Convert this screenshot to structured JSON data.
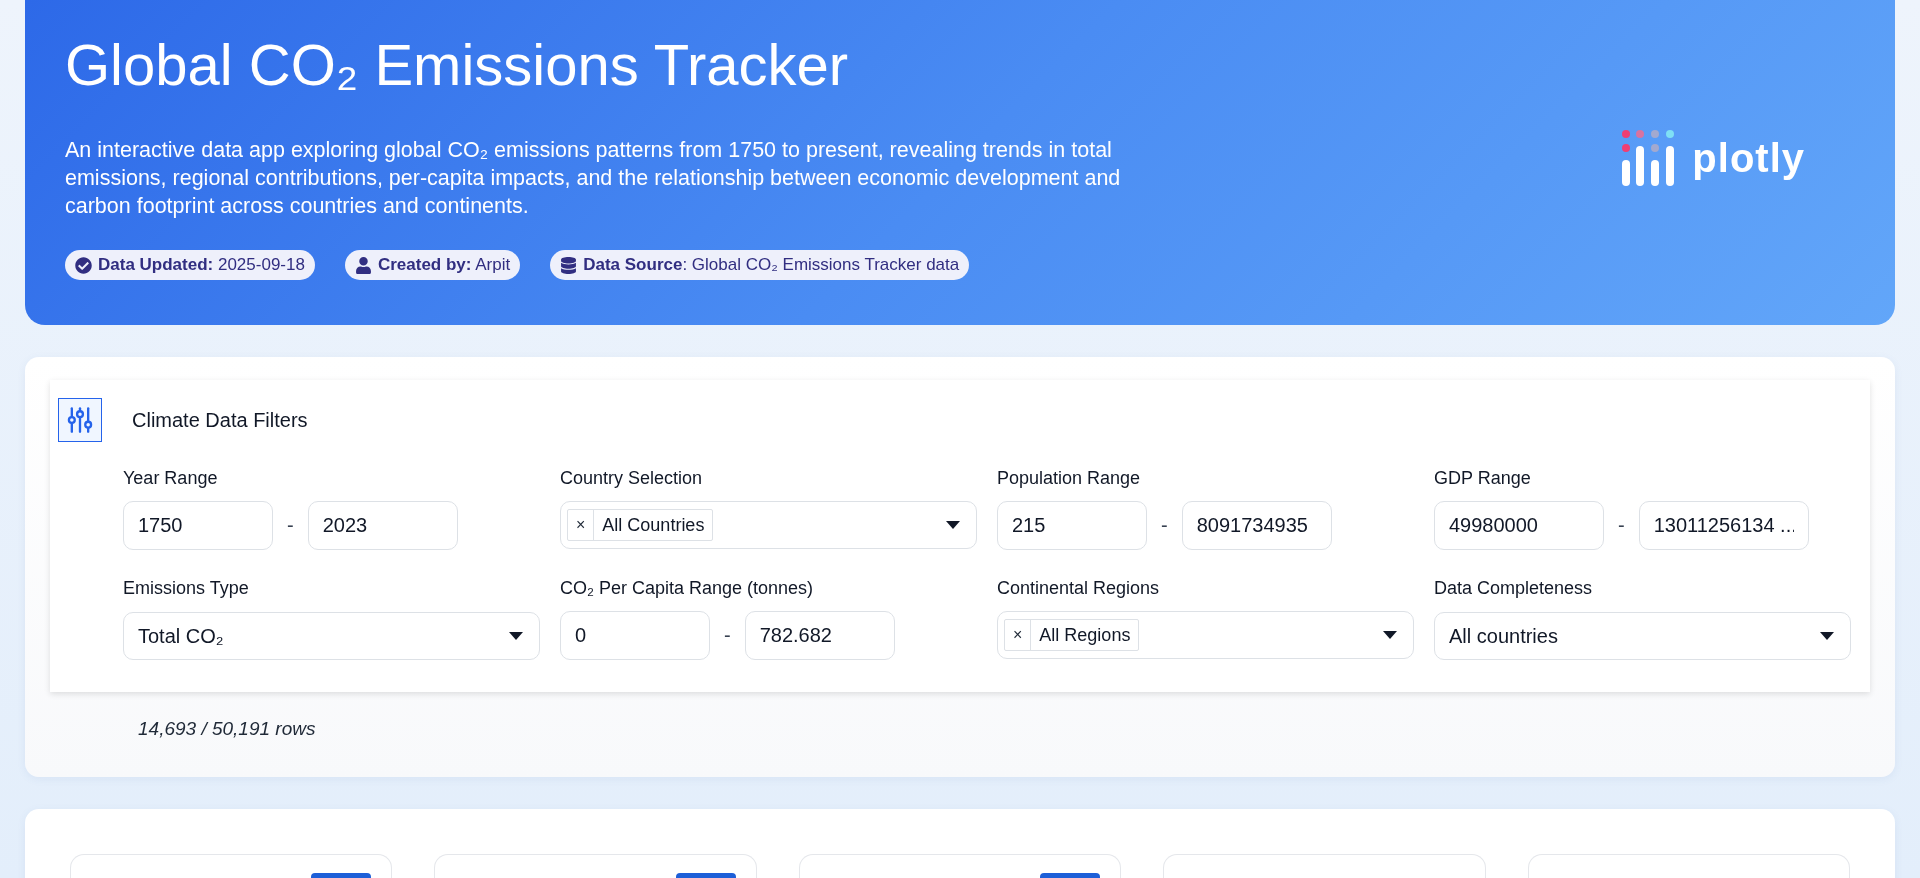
{
  "header": {
    "title": "Global CO₂ Emissions Tracker",
    "description": "An interactive data app exploring global CO₂ emissions patterns from 1750 to present, revealing trends in total emissions, regional contributions, per-capita impacts, and the relationship between economic development and carbon footprint across countries and continents.",
    "badges": [
      {
        "kind": "updated",
        "text": "**Data Updated:** 2025-09-18"
      },
      {
        "kind": "author",
        "text": "**Created by:** Arpit"
      },
      {
        "kind": "source",
        "text": "**Data Source**: Global CO₂ Emissions Tracker data"
      }
    ],
    "logo": "plotly"
  },
  "filters": {
    "title": "Climate Data Filters",
    "fields": [
      {
        "kind": "range",
        "label": "Year Range",
        "from": "1750",
        "separator": "-",
        "to": "2023"
      },
      {
        "kind": "multi",
        "label": "Country Selection",
        "tags": [
          {
            "remove": "×",
            "text": "All Countries"
          }
        ]
      },
      {
        "kind": "range",
        "label": "Population Range",
        "from": "215",
        "separator": "-",
        "to": "8091734935"
      },
      {
        "kind": "range",
        "label": "GDP Range",
        "from": "49980000",
        "separator": "-",
        "to": "13011256134 ..."
      },
      {
        "kind": "select",
        "label": "Emissions Type",
        "value": "Total CO₂"
      },
      {
        "kind": "range",
        "label": "CO₂ Per Capita Range (tonnes)",
        "from": "0",
        "separator": "-",
        "to": "782.682"
      },
      {
        "kind": "multi",
        "label": "Continental Regions",
        "tags": [
          {
            "remove": "×",
            "text": "All Regions"
          }
        ]
      },
      {
        "kind": "select",
        "label": "Data Completeness",
        "value": "All countries"
      }
    ],
    "row_count": "14,693 / 50,191 rows"
  },
  "kpi_cards": [
    {
      "highlighted": true
    },
    {
      "highlighted": true
    },
    {
      "highlighted": true
    },
    {
      "highlighted": false
    },
    {
      "highlighted": false
    }
  ]
}
